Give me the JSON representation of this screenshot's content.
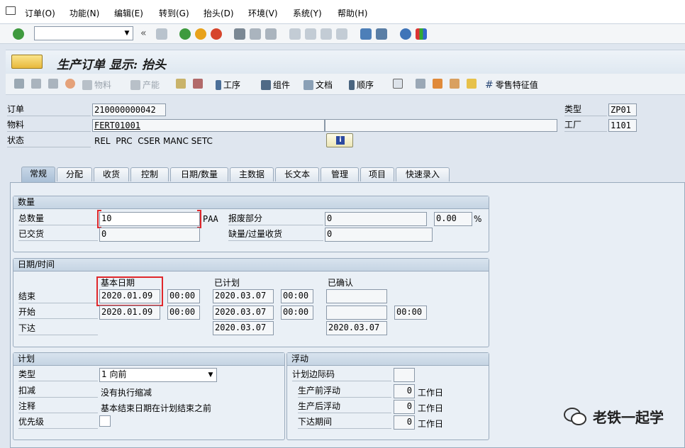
{
  "menu": [
    "订单(O)",
    "功能(N)",
    "编辑(E)",
    "转到(G)",
    "抬头(D)",
    "环境(V)",
    "系统(Y)",
    "帮助(H)"
  ],
  "title": "生产订单 显示: 抬头",
  "app_toolbar": {
    "material": "物料",
    "output": "产能",
    "operations": "工序",
    "components": "组件",
    "documents": "文档",
    "sequences": "顺序",
    "retail_char": "零售特征值"
  },
  "header": {
    "order_label": "订单",
    "order_value": "210000000042",
    "material_label": "物料",
    "material_value": "FERT01001",
    "status_label": "状态",
    "status_value": "REL  PRC  CSER MANC SETC",
    "type_label": "类型",
    "type_value": "ZP01",
    "plant_label": "工厂",
    "plant_value": "1101"
  },
  "tabs": [
    "常规",
    "分配",
    "收货",
    "控制",
    "日期/数量",
    "主数据",
    "长文本",
    "管理",
    "项目",
    "快速录入"
  ],
  "quantities": {
    "title": "数量",
    "total_label": "总数量",
    "total_value": "10",
    "unit": "PAA",
    "scrap_label": "报废部分",
    "scrap_value": "0",
    "scrap_pct": "0.00",
    "pct": "%",
    "delivered_label": "已交货",
    "delivered_value": "0",
    "short_label": "缺量/过量收货",
    "short_value": "0"
  },
  "dates": {
    "title": "日期/时间",
    "basic_label": "基本日期",
    "scheduled_label": "已计划",
    "confirmed_label": "已确认",
    "end_label": "结束",
    "start_label": "开始",
    "release_label": "下达",
    "basic_end": "2020.01.09",
    "basic_end_time": "00:00",
    "basic_start": "2020.01.09",
    "basic_start_time": "00:00",
    "sched_end": "2020.03.07",
    "sched_end_time": "00:00",
    "sched_start": "2020.03.07",
    "sched_start_time": "00:00",
    "sched_release": "2020.03.07",
    "conf_start_time": "00:00",
    "conf_release": "2020.03.07"
  },
  "scheduling": {
    "title": "计划",
    "type_label": "类型",
    "type_value": "1 向前",
    "reduction_label": "扣减",
    "reduction_value": "没有执行缩减",
    "note_label": "注释",
    "note_value": "基本结束日期在计划结束之前",
    "priority_label": "优先级"
  },
  "float": {
    "title": "浮动",
    "margin_label": "计划边际码",
    "before_label": "生产前浮动",
    "before_value": "0",
    "before_unit": "工作日",
    "after_label": "生产后浮动",
    "after_value": "0",
    "after_unit": "工作日",
    "release_label": "下达期间",
    "release_value": "0",
    "release_unit": "工作日"
  },
  "watermark": "老铁一起学",
  "colors": {
    "highlight": "#e0272b",
    "accent": "#a9bfd6"
  }
}
